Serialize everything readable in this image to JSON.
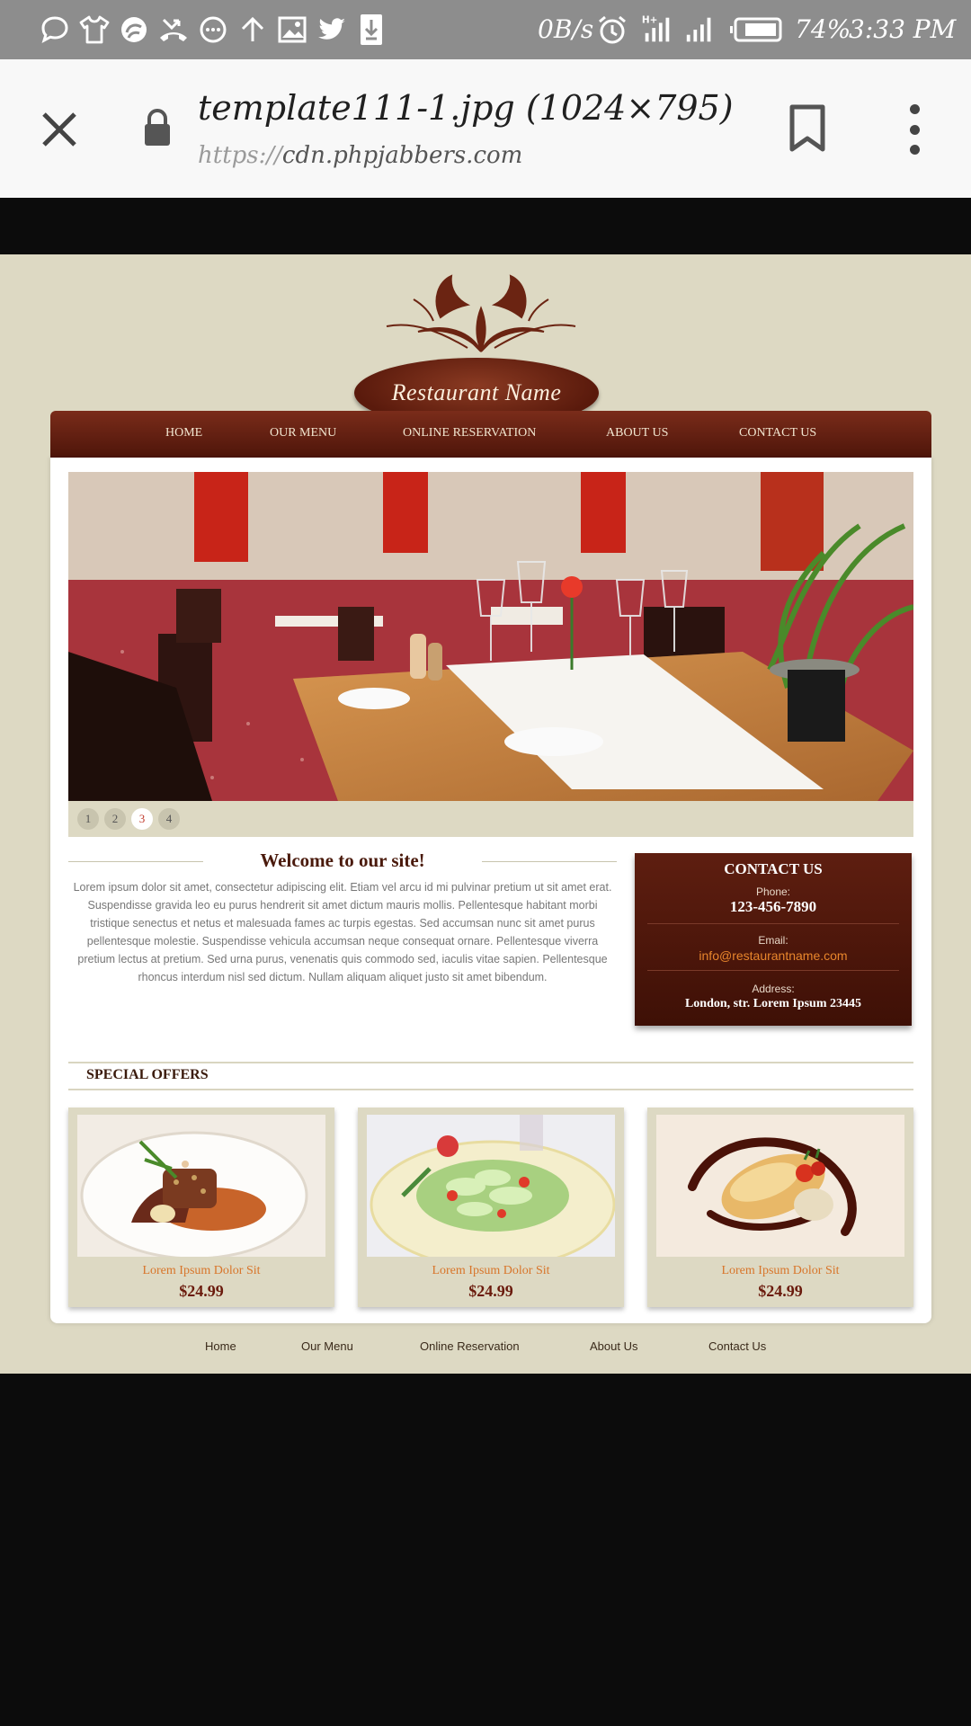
{
  "status_bar": {
    "network_speed": "0B/s",
    "battery": "74%",
    "time": "3:33 PM",
    "network_type": "H+",
    "icons": [
      "chat-bubble-icon",
      "tshirt-icon",
      "swirl-icon",
      "missed-call-icon",
      "chat-dots-icon",
      "upload-arrow-icon",
      "image-icon",
      "twitter-icon",
      "download-icon",
      "alarm-icon",
      "signal-icon",
      "signal-icon",
      "battery-icon"
    ]
  },
  "browser": {
    "title": "template111-1.jpg (1024×795)",
    "url_scheme": "https://",
    "url_host": "cdn.phpjabbers.com",
    "icons": [
      "close-icon",
      "lock-icon",
      "bookmark-icon",
      "more-vert-icon"
    ]
  },
  "site": {
    "logo_name": "Restaurant Name",
    "nav": [
      "HOME",
      "OUR MENU",
      "ONLINE RESERVATION",
      "ABOUT US",
      "CONTACT US"
    ],
    "slider_dots": [
      "1",
      "2",
      "3",
      "4"
    ],
    "active_slide": 3,
    "welcome_title": "Welcome to our site!",
    "welcome_text": "Lorem ipsum dolor sit amet, consectetur adipiscing elit. Etiam vel arcu id mi pulvinar pretium ut sit amet erat. Suspendisse gravida leo eu purus hendrerit sit amet dictum mauris mollis. Pellentesque habitant morbi tristique senectus et netus et malesuada fames ac turpis egestas. Sed accumsan nunc sit amet purus pellentesque molestie. Suspendisse vehicula accumsan neque consequat ornare. Pellentesque viverra pretium lectus at pretium. Sed urna purus, venenatis quis commodo sed, iaculis vitae sapien. Pellentesque rhoncus interdum nisl sed dictum. Nullam aliquam aliquet justo sit amet bibendum.",
    "contact": {
      "heading": "CONTACT US",
      "phone_label": "Phone:",
      "phone": "123-456-7890",
      "email_label": "Email:",
      "email": "info@restaurantname.com",
      "address_label": "Address:",
      "address": "London, str. Lorem Ipsum 23445"
    },
    "offers_title": "SPECIAL OFFERS",
    "offers": [
      {
        "name": "Lorem Ipsum Dolor Sit",
        "price": "$24.99"
      },
      {
        "name": "Lorem Ipsum Dolor Sit",
        "price": "$24.99"
      },
      {
        "name": "Lorem Ipsum Dolor Sit",
        "price": "$24.99"
      }
    ],
    "footer_nav": [
      "Home",
      "Our Menu",
      "Online Reservation",
      "About Us",
      "Contact Us"
    ]
  },
  "colors": {
    "status_bar": "#8d8d8d",
    "browser_bar": "#f8f8f8",
    "site_bg": "#ddd9c3",
    "brand_brown": "#5e1e10",
    "accent_orange": "#e8862c"
  }
}
